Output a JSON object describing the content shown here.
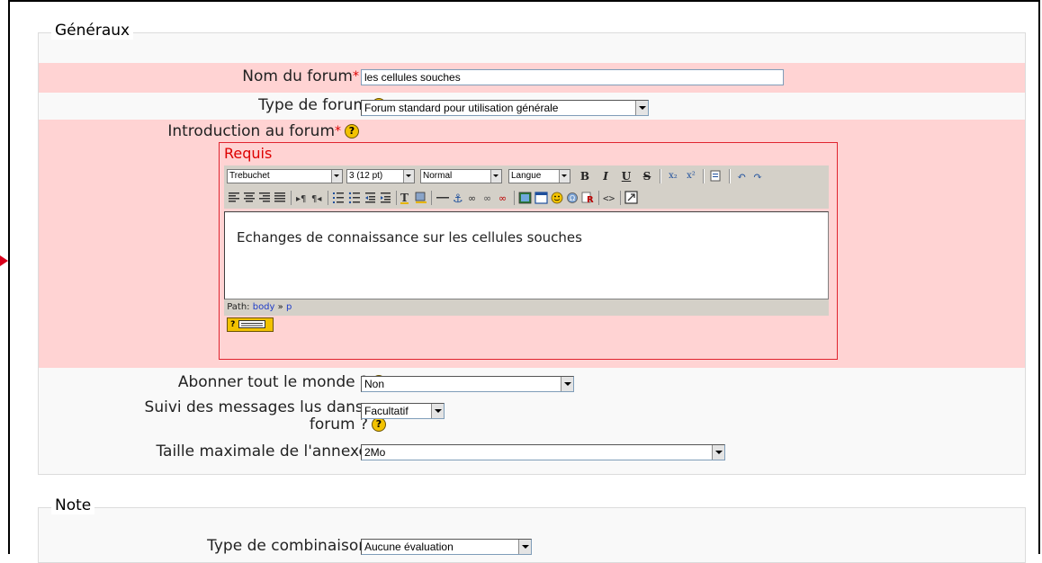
{
  "sections": {
    "general": {
      "legend": "Généraux",
      "forum_name": {
        "label": "Nom du forum",
        "required_mark": "*",
        "value": "les cellules souches"
      },
      "forum_type": {
        "label": "Type de forum",
        "value": "Forum standard pour utilisation générale"
      },
      "intro": {
        "label": "Introduction au forum",
        "required_mark": "*",
        "requis": "Requis",
        "editor_text": "Echanges de connaissance sur les cellules souches",
        "path_label": "Path:",
        "path_body": "body",
        "path_sep": "»",
        "path_p": "p"
      },
      "subscribe": {
        "label": "Abonner tout le monde ?",
        "value": "Non"
      },
      "tracking": {
        "label_line1": "Suivi des messages lus dans ce",
        "label_line2": "forum ?",
        "value": "Facultatif"
      },
      "attachment": {
        "label": "Taille maximale de l'annexe",
        "value": "2Mo"
      }
    },
    "grade": {
      "legend": "Note",
      "aggregate": {
        "label": "Type de combinaison",
        "value": "Aucune évaluation"
      }
    }
  },
  "toolbar": {
    "font": "Trebuchet",
    "size": "3 (12 pt)",
    "format": "Normal",
    "lang": "Langue",
    "bold": "B",
    "italic": "I",
    "underline": "U",
    "strike": "S",
    "sub": "x₂",
    "sup": "x²",
    "undo": "↶",
    "redo": "↷",
    "row2_icons": [
      "align-left-icon",
      "align-center-icon",
      "align-right-icon",
      "justify-icon",
      "ltr-icon",
      "rtl-icon",
      "ordered-list-icon",
      "unordered-list-icon",
      "outdent-icon",
      "indent-icon",
      "text-color-icon",
      "bg-color-icon",
      "hr-icon",
      "anchor-icon",
      "link-icon",
      "unlink-icon",
      "nolink-icon",
      "image-icon",
      "table-icon",
      "smiley-icon",
      "special-char-icon",
      "search-replace-icon",
      "html-source-icon",
      "fullscreen-icon"
    ]
  },
  "help_glyph": "?",
  "colors": {
    "required_row": "#ffd3d3",
    "required_border": "#e0242f",
    "help": "#f2c200"
  }
}
